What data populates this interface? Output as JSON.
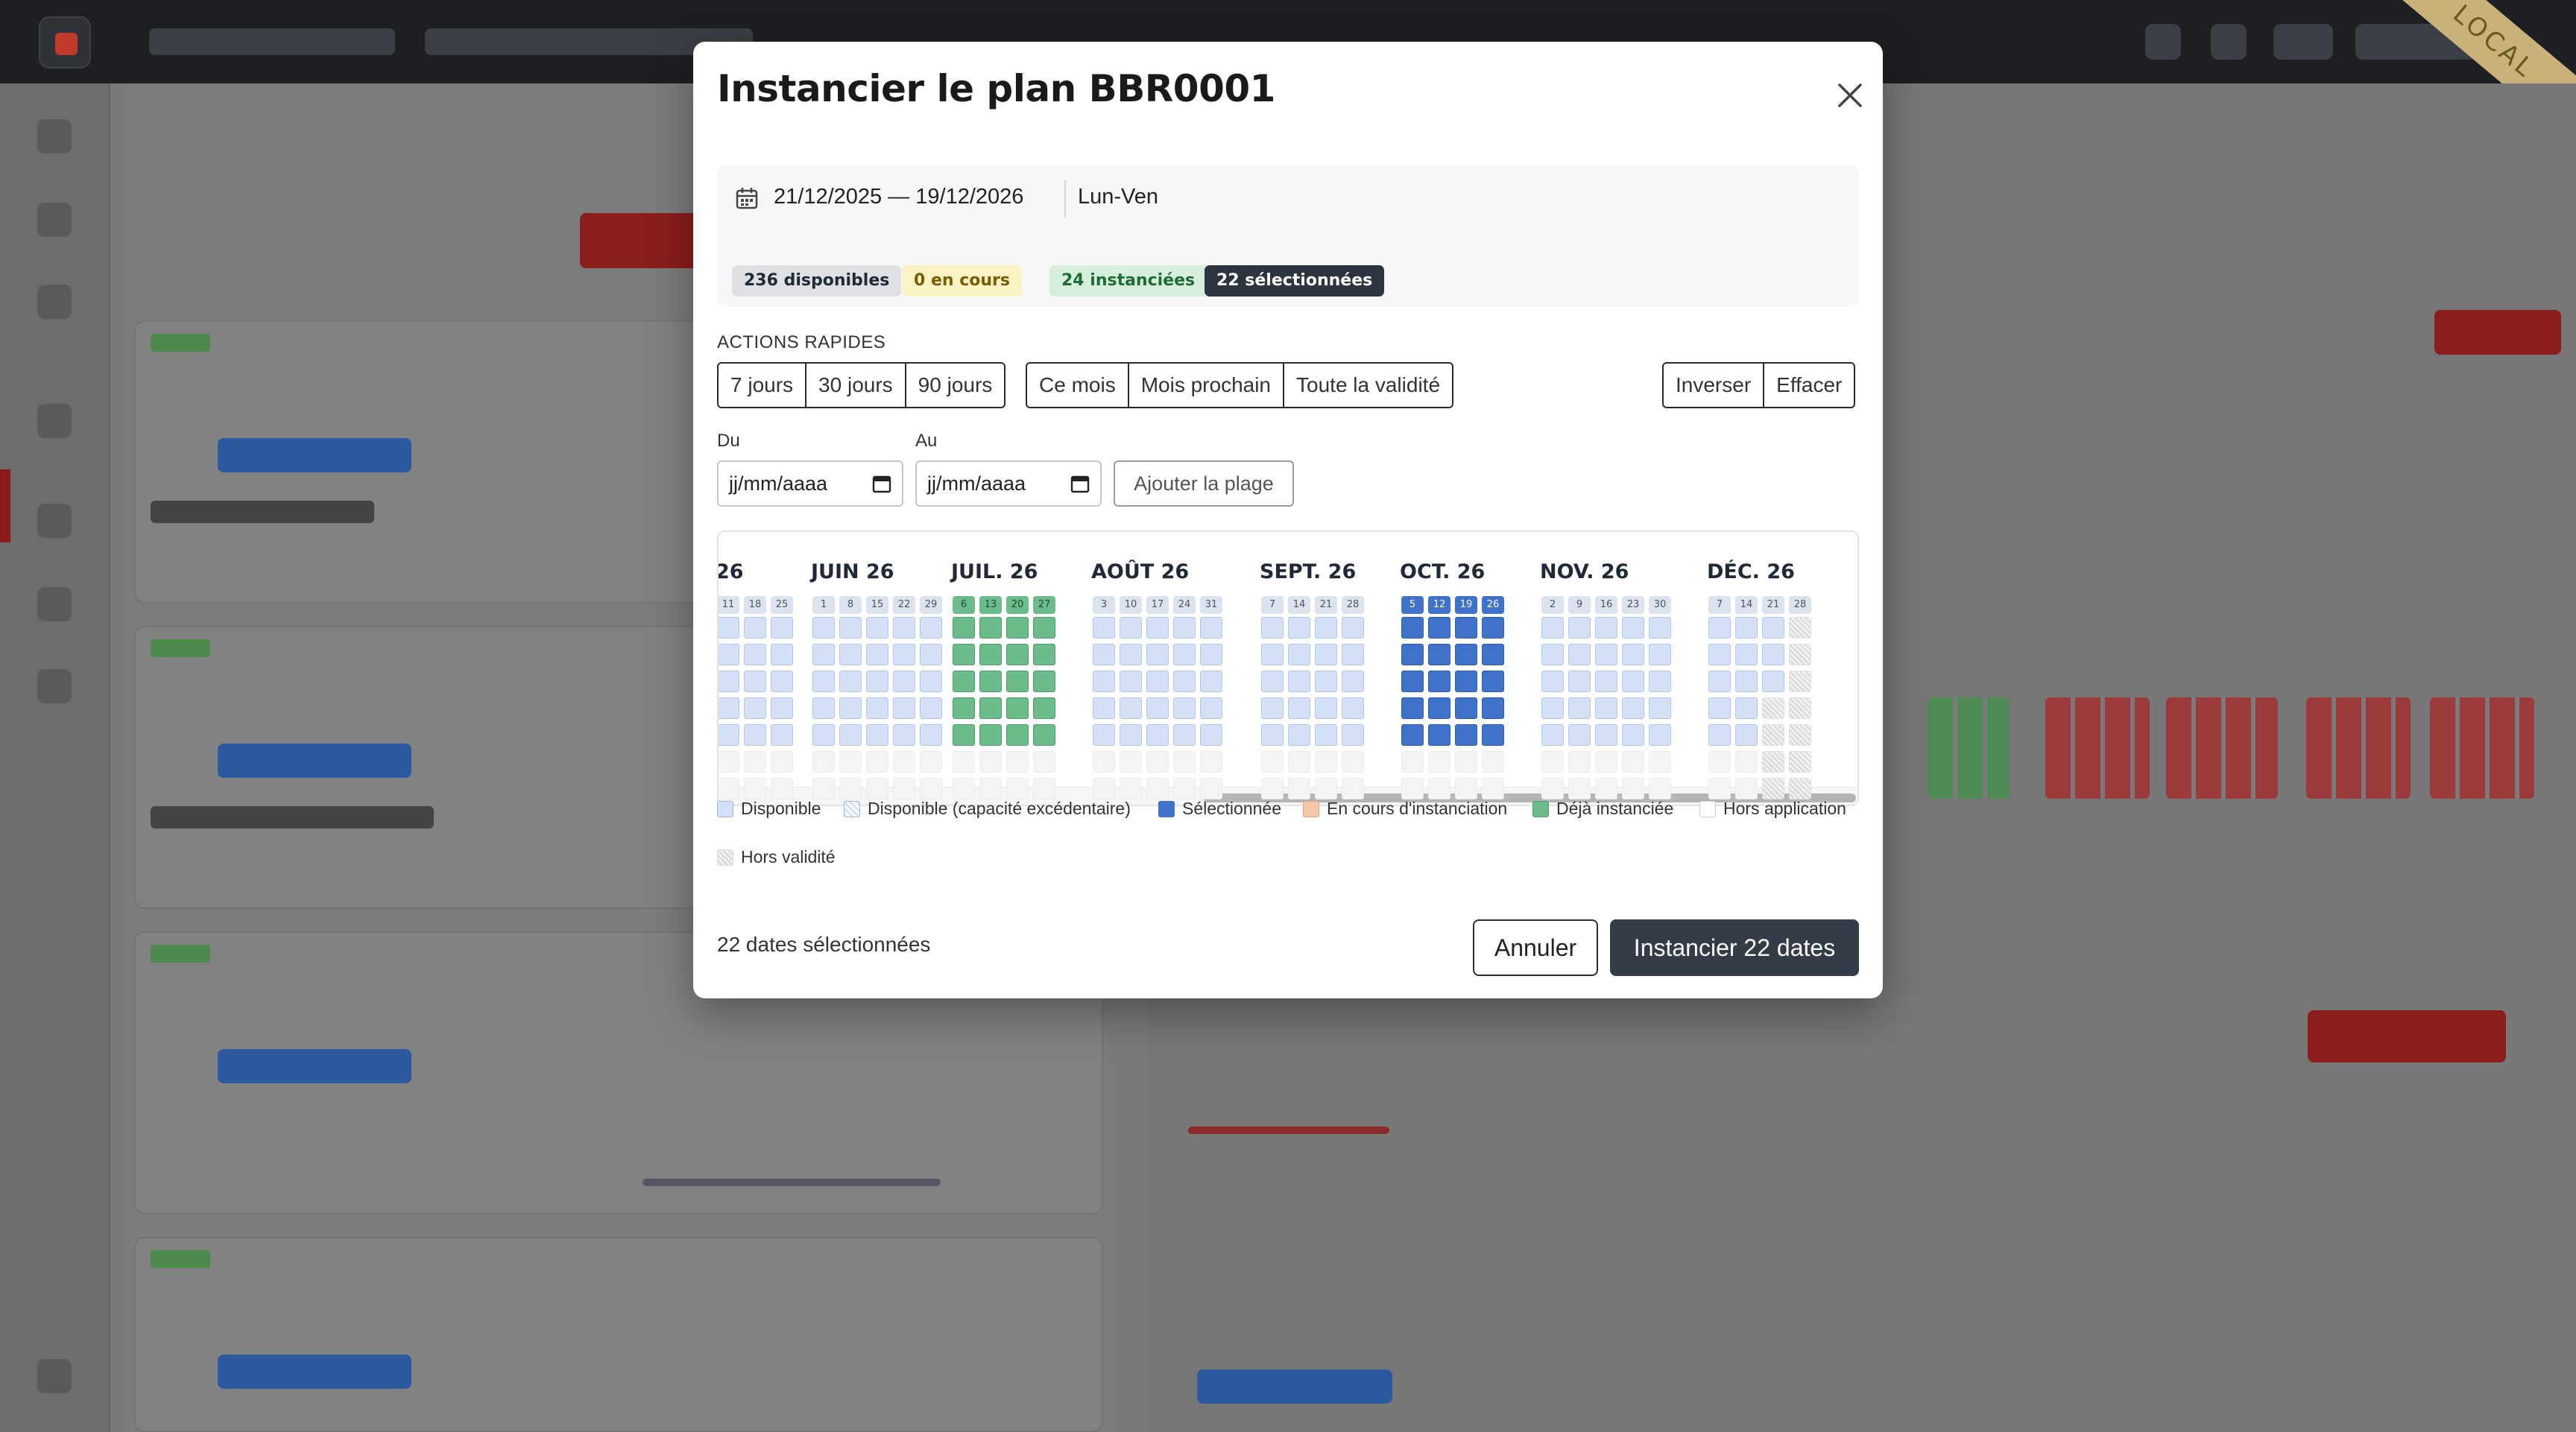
{
  "app": {
    "badge": "LOCAL"
  },
  "modal": {
    "title": "Instancier le plan BBR0001",
    "summary": {
      "range": "21/12/2025 — 19/12/2026",
      "days": "Lun-Ven",
      "chips": {
        "available": "236 disponibles",
        "in_progress": "0 en cours",
        "instantiated": "24 instanciées",
        "selected": "22 sélectionnées"
      }
    },
    "quick_actions": {
      "label": "ACTIONS RAPIDES",
      "group1": [
        "7 jours",
        "30 jours",
        "90 jours"
      ],
      "group2": [
        "Ce mois",
        "Mois prochain",
        "Toute la validité"
      ],
      "group3": [
        "Inverser",
        "Effacer"
      ]
    },
    "range_form": {
      "from_label": "Du",
      "to_label": "Au",
      "from_placeholder": "jj/mm/aaaa",
      "to_placeholder": "jj/mm/aaaa",
      "add_label": "Ajouter la plage"
    },
    "calendar": {
      "months": [
        {
          "name": "26",
          "weeks": [
            "11",
            "18",
            "25"
          ]
        },
        {
          "name": "JUIN 26",
          "weeks": [
            "1",
            "8",
            "15",
            "22",
            "29"
          ]
        },
        {
          "name": "JUIL. 26",
          "weeks": [
            "6",
            "13",
            "20",
            "27"
          ]
        },
        {
          "name": "AOÛT 26",
          "weeks": [
            "3",
            "10",
            "17",
            "24",
            "31"
          ]
        },
        {
          "name": "SEPT. 26",
          "weeks": [
            "7",
            "14",
            "21",
            "28"
          ]
        },
        {
          "name": "OCT. 26",
          "weeks": [
            "5",
            "12",
            "19",
            "26"
          ]
        },
        {
          "name": "NOV. 26",
          "weeks": [
            "2",
            "9",
            "16",
            "23",
            "30"
          ]
        },
        {
          "name": "DÉC. 26",
          "weeks": [
            "7",
            "14",
            "21",
            "28"
          ]
        }
      ]
    },
    "legend": {
      "available": "Disponible",
      "available_over": "Disponible (capacité excédentaire)",
      "selected": "Sélectionnée",
      "in_progress": "En cours d'instanciation",
      "instantiated": "Déjà instanciée",
      "out_of_application": "Hors application",
      "out_of_validity": "Hors validité"
    },
    "footer": {
      "count_text": "22 dates sélectionnées",
      "cancel_label": "Annuler",
      "submit_label": "Instancier 22 dates"
    }
  },
  "colors": {
    "available": "#d3e0f5",
    "selected": "#3f72c8",
    "in_progress": "#f4c7a8",
    "instantiated": "#6cbb8a",
    "primary_button": "#343c48"
  }
}
